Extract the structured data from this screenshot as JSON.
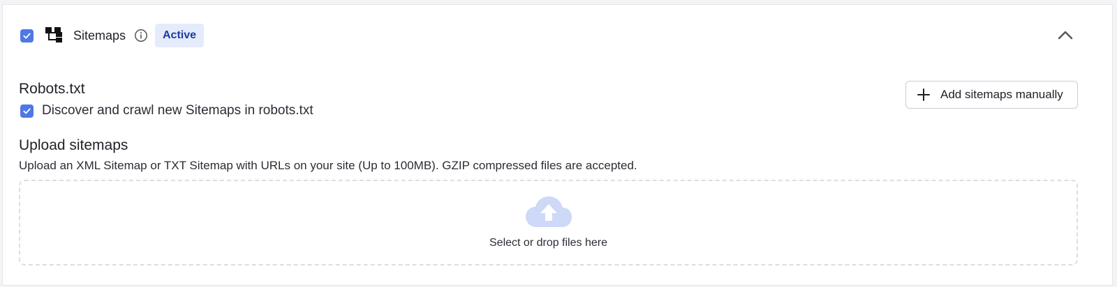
{
  "header": {
    "title": "Sitemaps",
    "status_badge": "Active",
    "enabled_checked": true,
    "icons": [
      "sitemap-icon",
      "info-icon",
      "chevron-up-icon"
    ]
  },
  "robots": {
    "title": "Robots.txt",
    "checkbox_label": "Discover and crawl new Sitemaps in robots.txt",
    "checked": true
  },
  "actions": {
    "add_sitemaps_label": "Add sitemaps manually",
    "add_icon": "plus-icon"
  },
  "upload": {
    "title": "Upload sitemaps",
    "description": "Upload an XML Sitemap or TXT Sitemap with URLs on your site (Up to 100MB). GZIP compressed files are accepted.",
    "dropzone_label": "Select or drop files here",
    "dropzone_icon": "cloud-upload-icon"
  },
  "colors": {
    "accent": "#4e78e6",
    "badge_bg": "#e4ebfb",
    "badge_text": "#1e3aa0",
    "cloud": "#cdd9f7"
  }
}
